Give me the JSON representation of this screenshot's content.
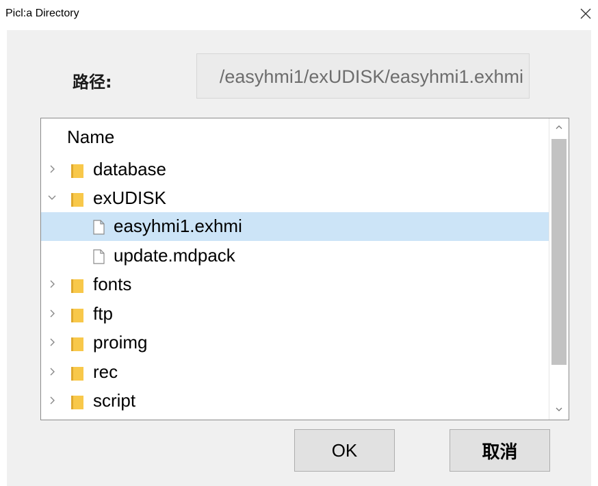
{
  "window": {
    "title": "Picl:a Directory",
    "close_icon": "close-icon"
  },
  "path": {
    "label": "路径:",
    "value": "/easyhmi1/exUDISK/easyhmi1.exhmi"
  },
  "tree": {
    "header": "Name",
    "rows": [
      {
        "label": "database",
        "type": "folder",
        "expander": "collapsed",
        "selected": false
      },
      {
        "label": "exUDISK",
        "type": "folder",
        "expander": "expanded",
        "selected": false
      },
      {
        "label": "easyhmi1.exhmi",
        "type": "file",
        "expander": "none",
        "selected": true
      },
      {
        "label": "update.mdpack",
        "type": "file",
        "expander": "none",
        "selected": false
      },
      {
        "label": "fonts",
        "type": "folder",
        "expander": "collapsed",
        "selected": false
      },
      {
        "label": "ftp",
        "type": "folder",
        "expander": "collapsed",
        "selected": false
      },
      {
        "label": "proimg",
        "type": "folder",
        "expander": "collapsed",
        "selected": false
      },
      {
        "label": "rec",
        "type": "folder",
        "expander": "collapsed",
        "selected": false
      },
      {
        "label": "script",
        "type": "folder",
        "expander": "collapsed",
        "selected": false
      }
    ]
  },
  "buttons": {
    "ok": "OK",
    "cancel": "取消"
  },
  "colors": {
    "selection": "#cce4f7",
    "folder": "#f8c84a",
    "dialog_bg": "#f0f0f0"
  }
}
